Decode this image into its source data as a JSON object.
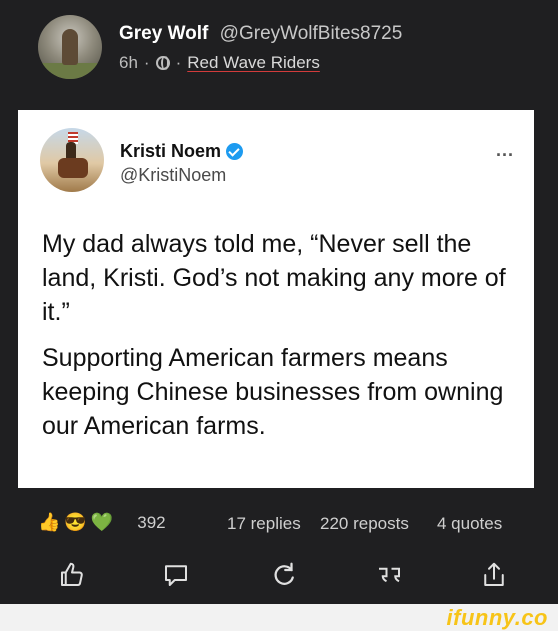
{
  "post": {
    "author_name": "Grey Wolf",
    "author_handle": "@GreyWolfBites8725",
    "time": "6h",
    "separator": "·",
    "community": "Red Wave Riders"
  },
  "tweet": {
    "name": "Kristi Noem",
    "handle": "@KristiNoem",
    "more": "...",
    "paragraph1": "My dad always told me, “Never sell the land, Kristi. God’s not making any more of it.”",
    "paragraph2": "Supporting American farmers means keeping Chinese businesses from owning our American farms."
  },
  "stats": {
    "reaction_count": "392",
    "replies": "17 replies",
    "reposts": "220 reposts",
    "quotes": "4 quotes"
  },
  "icons": {
    "like": "like-icon",
    "reply": "reply-icon",
    "repost": "repost-icon",
    "quote": "quote-icon",
    "share": "share-icon"
  },
  "footer": {
    "logo": "ifunny.co"
  },
  "colors": {
    "background": "#1f1f21",
    "card": "#ffffff",
    "verified": "#1d9bf0",
    "logo": "#f7c418",
    "community_underline": "#d23b3b"
  }
}
